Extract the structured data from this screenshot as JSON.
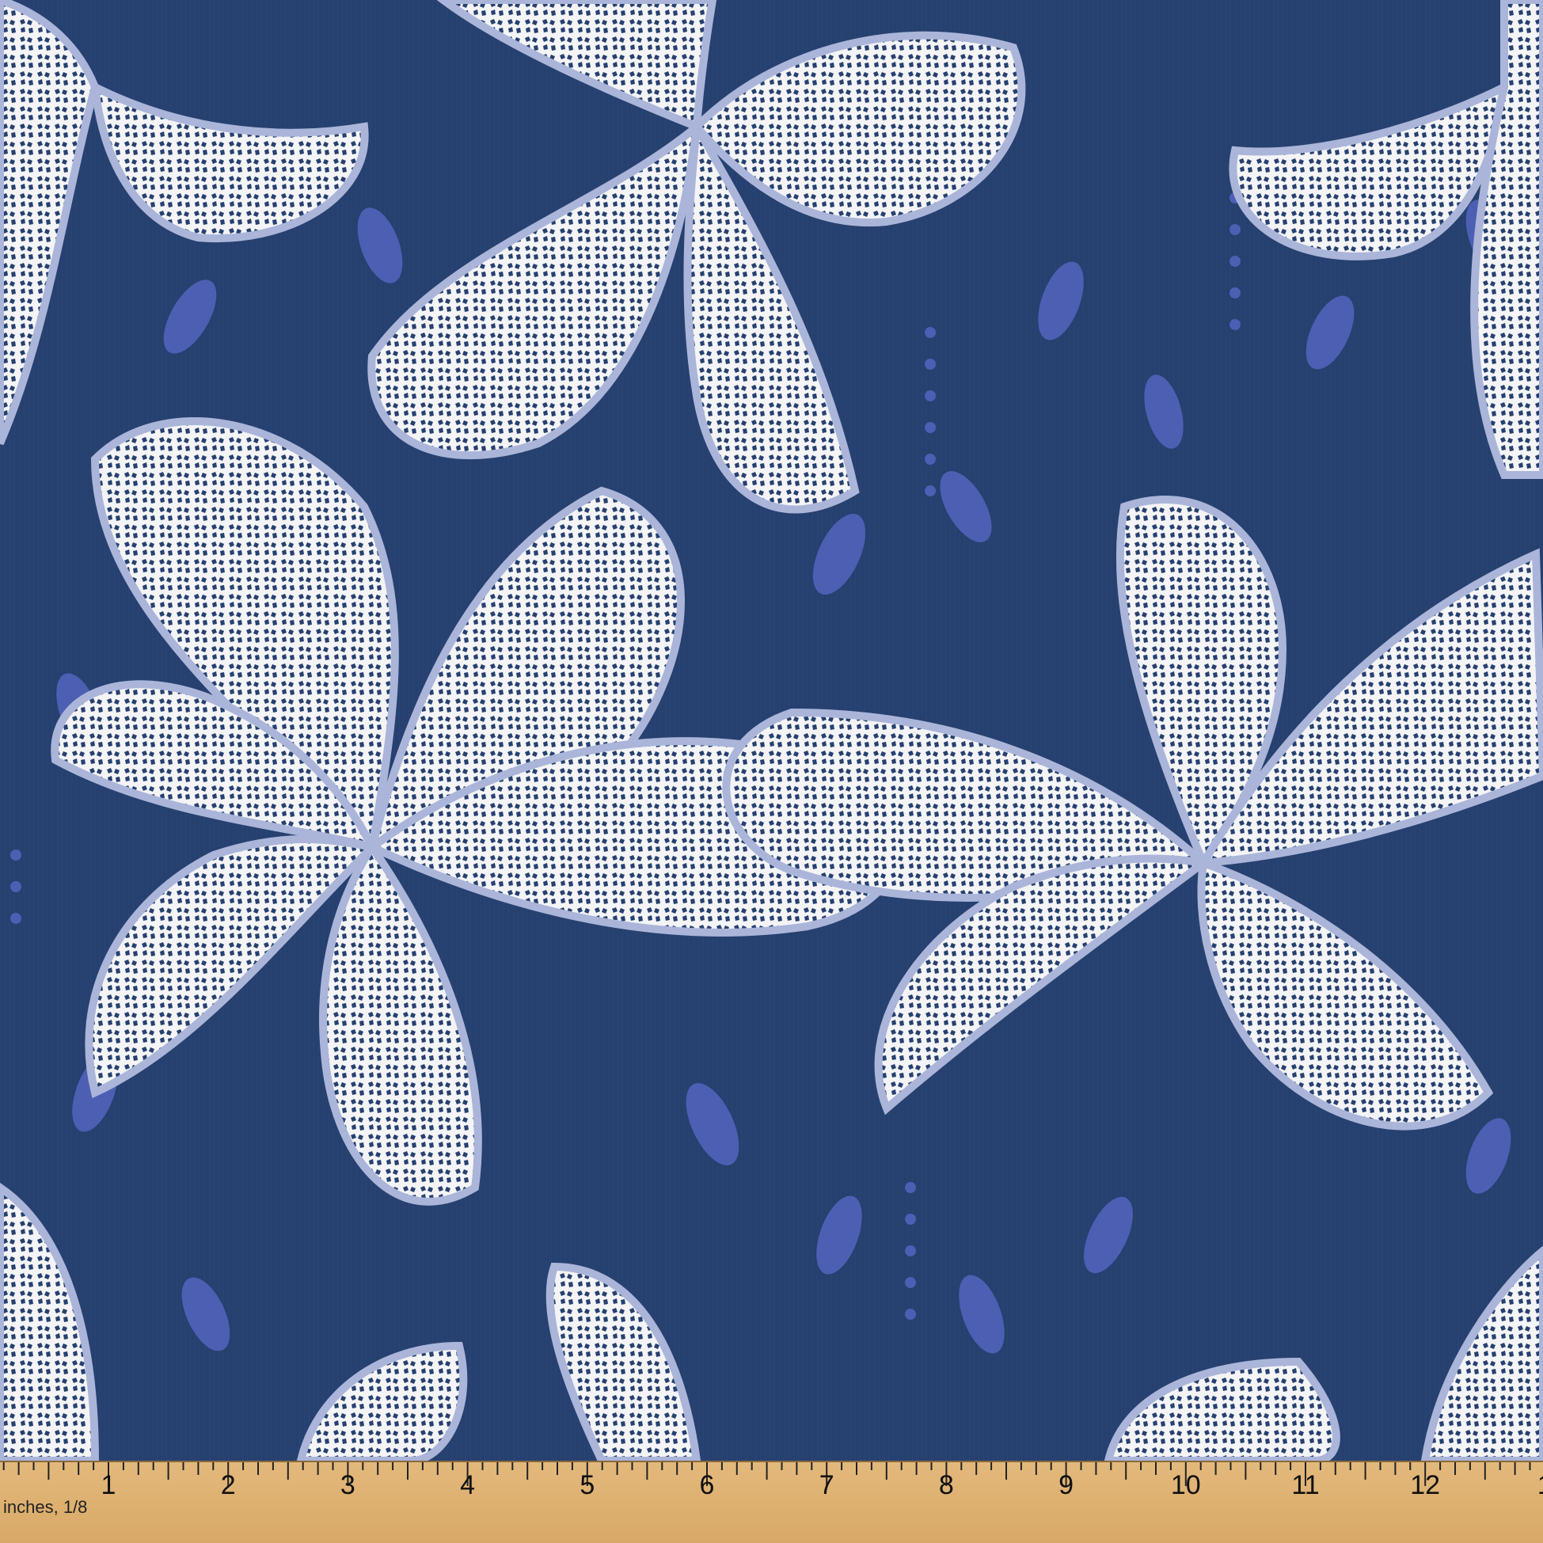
{
  "fabric": {
    "colors": {
      "background": "#26406f",
      "leaf": "#4d5fb3",
      "petal": "#f4f4f6",
      "speckle": "#26406f",
      "outline": "#aab5d9"
    }
  },
  "ruler": {
    "unit_label": "inches, 1/8",
    "numbers": [
      "1",
      "2",
      "3",
      "4",
      "5",
      "6",
      "7",
      "8",
      "9",
      "10",
      "11",
      "12",
      "1"
    ],
    "color": "#dcb070"
  }
}
